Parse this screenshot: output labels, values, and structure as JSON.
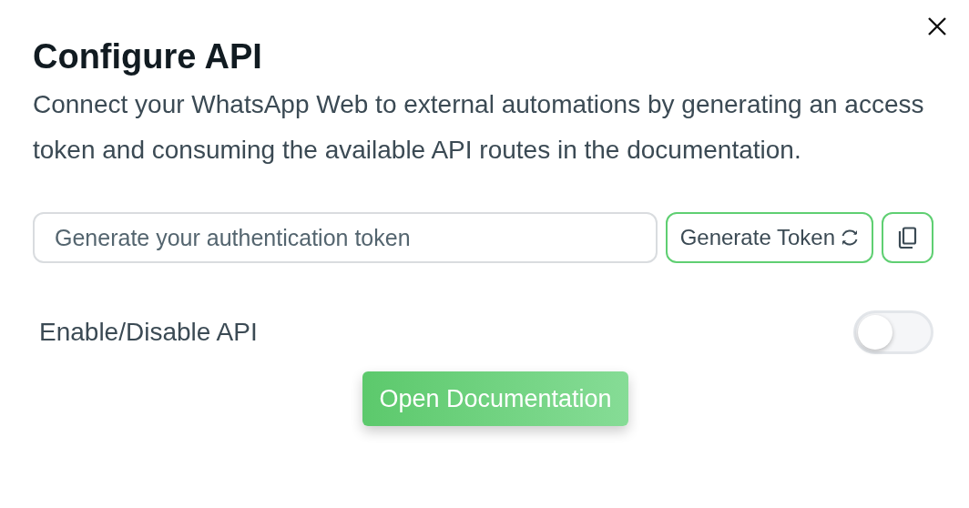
{
  "dialog": {
    "title": "Configure API",
    "description": "Connect your WhatsApp Web to external automations by generating an access token and consuming the available API routes in the documentation.",
    "token_field": {
      "placeholder": "Generate your authentication token"
    },
    "generate_button": "Generate Token",
    "toggle": {
      "label": "Enable/Disable API",
      "on": false
    },
    "docs_button": "Open Documentation"
  }
}
